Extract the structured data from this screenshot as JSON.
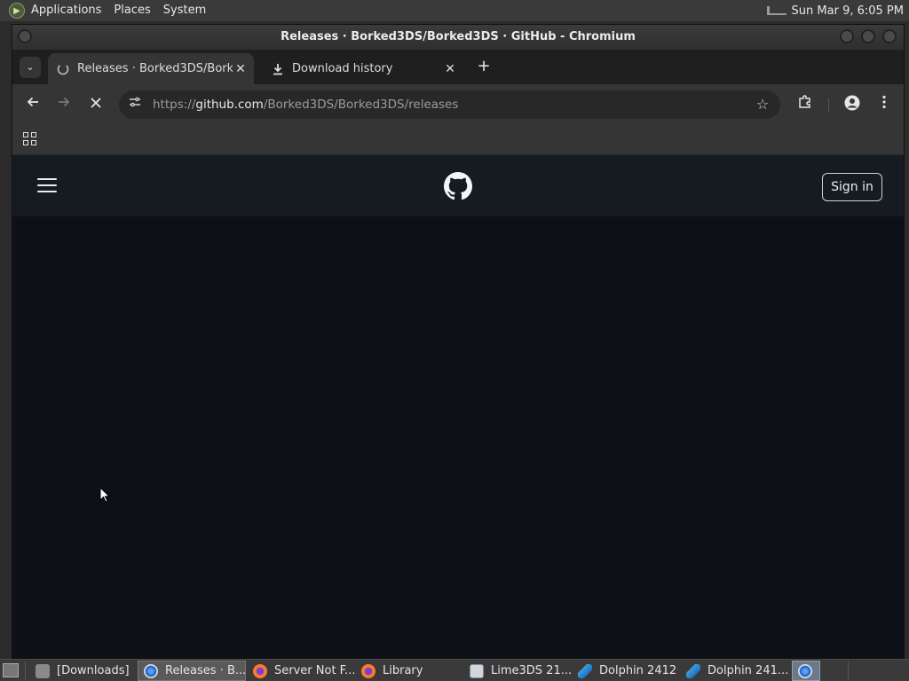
{
  "top_panel": {
    "menus": [
      "Applications",
      "Places",
      "System"
    ],
    "clock": "Sun Mar 9,  6:05 PM"
  },
  "window": {
    "title": "Releases · Borked3DS/Borked3DS · GitHub - Chromium"
  },
  "tabs": [
    {
      "title": "Releases · Borked3DS/Borked3DS · GitHub",
      "active": true,
      "icon": "loading-spinner-icon"
    },
    {
      "title": "Download history",
      "active": false,
      "icon": "download-icon"
    }
  ],
  "toolbar": {
    "url_scheme": "https://",
    "url_host": "github.com",
    "url_path": "/Borked3DS/Borked3DS/releases"
  },
  "github": {
    "signin_label": "Sign in"
  },
  "taskbar": {
    "tasks": [
      {
        "label": "[Downloads]",
        "icon": "folder-icon"
      },
      {
        "label": "Releases · B...",
        "icon": "chromium-icon",
        "active": true
      },
      {
        "label": "Server Not F...",
        "icon": "firefox-icon"
      },
      {
        "label": "Library",
        "icon": "firefox-icon"
      },
      {
        "label": "Lime3DS 21...",
        "icon": "window-icon"
      },
      {
        "label": "Dolphin 2412",
        "icon": "dolphin-icon"
      },
      {
        "label": "Dolphin 241...",
        "icon": "dolphin-icon"
      }
    ]
  },
  "colors": {
    "page_bg": "#0d1117",
    "header_bg": "#161b22",
    "chrome_toolbar": "#353535"
  }
}
